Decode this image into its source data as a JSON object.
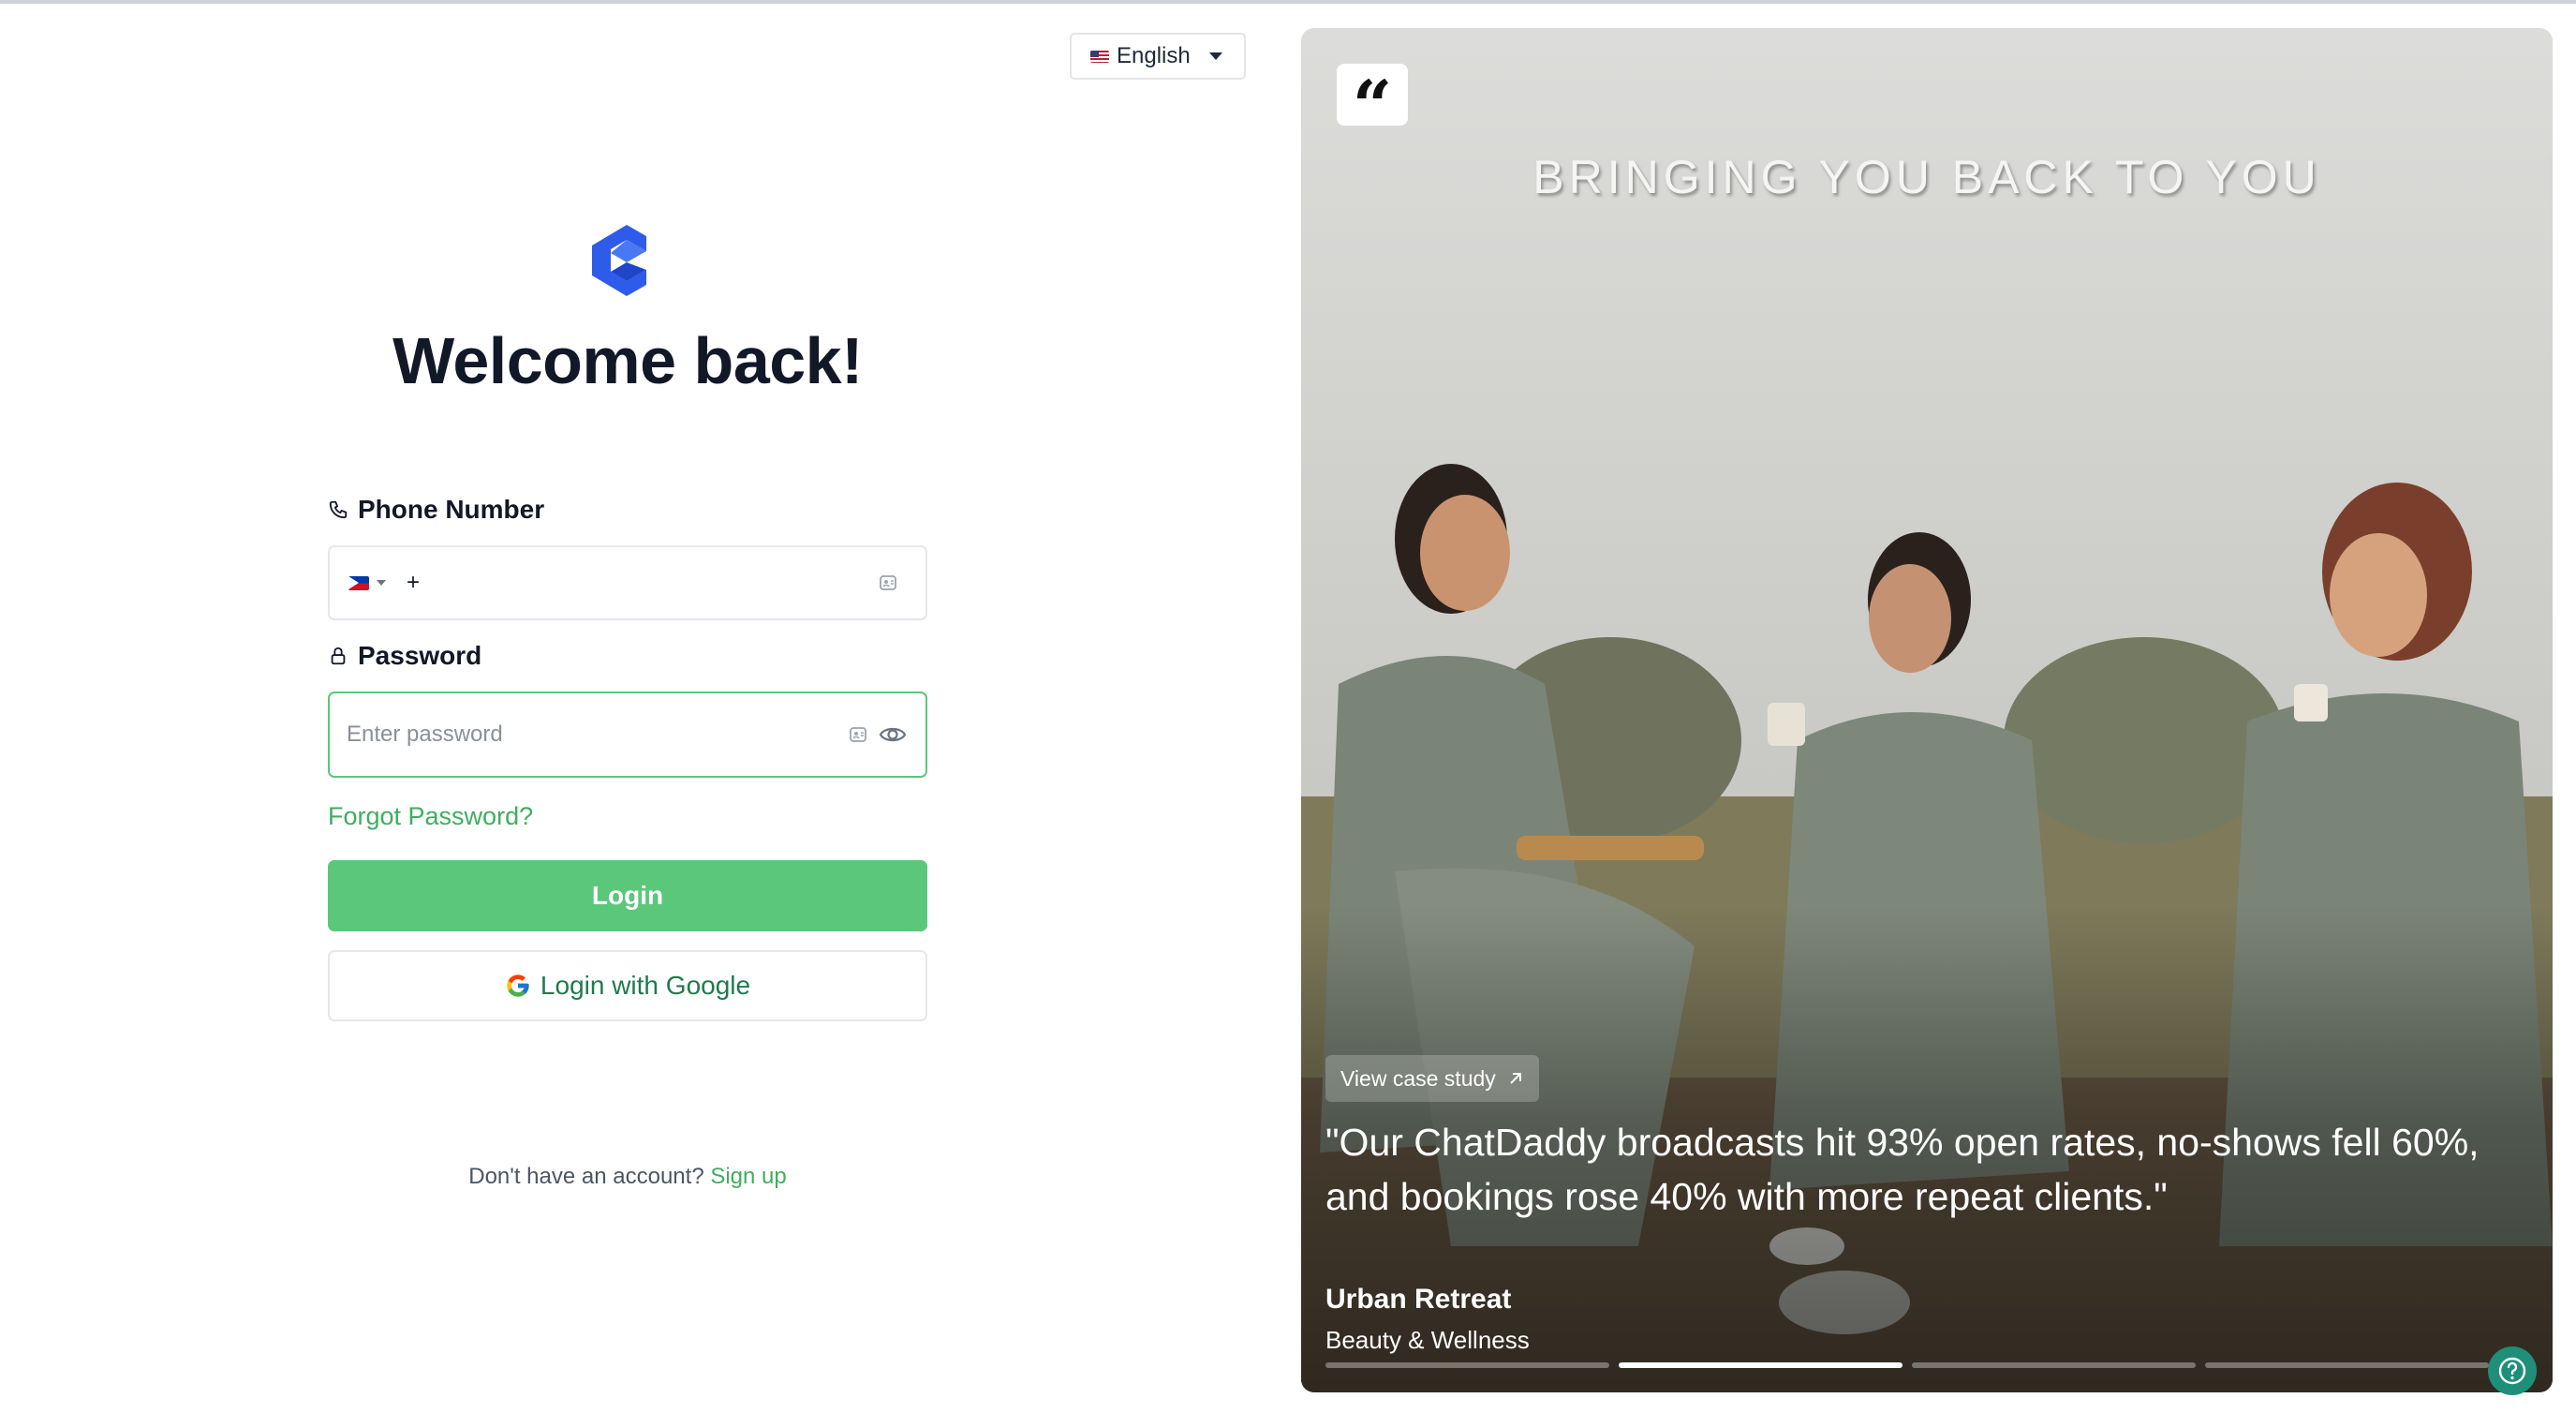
{
  "language": {
    "label": "English",
    "flag": "us-flag-icon"
  },
  "brand": {
    "logo_color": "#2f5bea"
  },
  "heading": "Welcome back!",
  "phone": {
    "label": "Phone Number",
    "country_flag": "ph-flag-icon",
    "prefix": "+",
    "value": ""
  },
  "password": {
    "label": "Password",
    "placeholder": "Enter password"
  },
  "forgot_label": "Forgot Password?",
  "login_label": "Login",
  "google_label": "Login with Google",
  "signup": {
    "prompt": "Don't have an account?",
    "link": "Sign up"
  },
  "testimonial": {
    "wall_text": "BRINGING YOU BACK TO YOU",
    "case_study_label": "View case study",
    "quote": "\"Our ChatDaddy broadcasts hit 93% open rates, no-shows fell 60%, and bookings rose 40% with more repeat clients.\"",
    "company": "Urban Retreat",
    "industry": "Beauty & Wellness",
    "slides_total": 4,
    "active_slide": 2
  },
  "colors": {
    "accent_green": "#5bc77b",
    "link_green": "#3fae5e",
    "help_teal": "#1f8f7a"
  }
}
